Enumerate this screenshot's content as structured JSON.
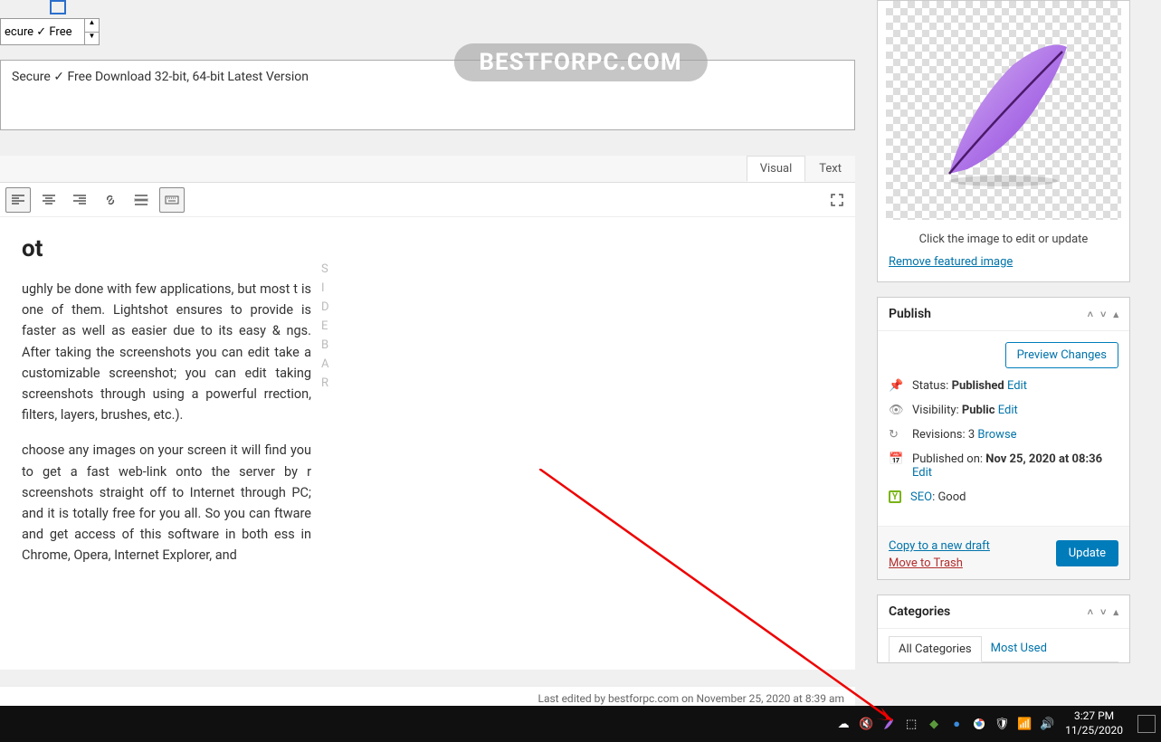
{
  "watermark": "BESTFORPC.COM",
  "top_input_text": "ecure ✓ Free",
  "description": "Secure ✓ Free Download 32-bit, 64-bit Latest Version",
  "editor": {
    "tabs": {
      "visual": "Visual",
      "text": "Text"
    }
  },
  "content": {
    "title_fragment": "ot",
    "para1": "ughly be done with few applications, but most t is one of them. Lightshot ensures to provide is faster as well as easier due to its easy & ngs. After taking the screenshots you can edit take a customizable screenshot; you can edit taking screenshots through using a powerful rrection, filters, layers, brushes, etc.).",
    "para2": "choose any images on your screen it will find you to get a fast web-link onto the server by r screenshots straight off to Internet through PC; and it is totally free for you all. So you can ftware and get access of this software in both ess in Chrome, Opera, Internet Explorer, and"
  },
  "sidebar_letters": [
    "S",
    "I",
    "D",
    "E",
    "B",
    "A",
    "R"
  ],
  "last_edited": "Last edited by bestforpc.com on November 25, 2020 at 8:39 am",
  "featured": {
    "caption": "Click the image to edit or update",
    "remove": "Remove featured image"
  },
  "publish": {
    "title": "Publish",
    "preview": "Preview Changes",
    "status_label": "Status:",
    "status_value": "Published",
    "visibility_label": "Visibility:",
    "visibility_value": "Public",
    "revisions_label": "Revisions:",
    "revisions_value": "3",
    "browse": "Browse",
    "published_label": "Published on:",
    "published_value": "Nov 25, 2020 at 08:36",
    "seo_label": "SEO",
    "seo_value": "Good",
    "edit": "Edit",
    "copy": "Copy to a new draft",
    "trash": "Move to Trash",
    "update": "Update"
  },
  "categories": {
    "title": "Categories",
    "all": "All Categories",
    "most_used": "Most Used"
  },
  "taskbar": {
    "time": "3:27 PM",
    "date": "11/25/2020"
  }
}
